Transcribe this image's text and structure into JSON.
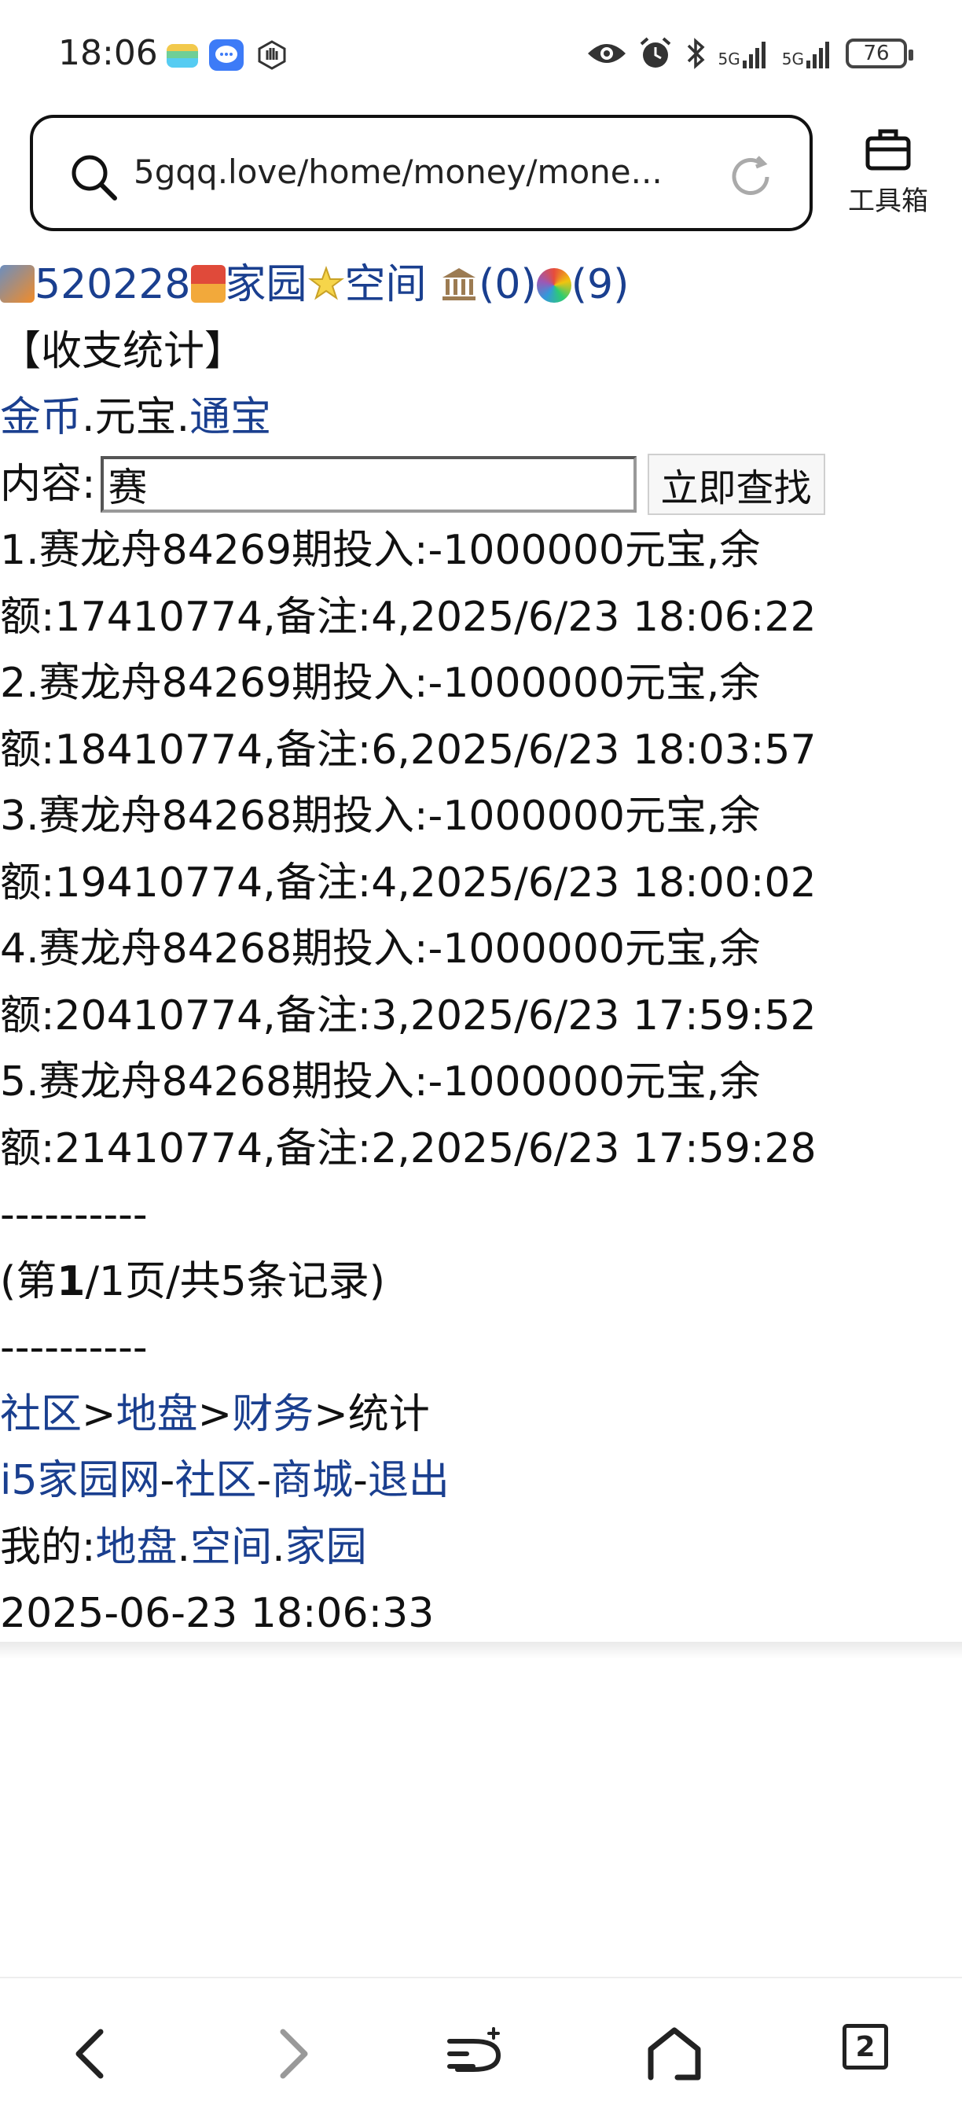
{
  "status_bar": {
    "time": "18:06",
    "battery": "76",
    "network_1": "5G",
    "network_2": "5G",
    "icons": [
      "sim-card-icon",
      "message-icon",
      "hand-icon",
      "eye-icon",
      "alarm-icon",
      "bluetooth-icon",
      "signal-icon",
      "battery-icon"
    ]
  },
  "browser": {
    "url": "5gqq.love/home/money/mone...",
    "toolbox_label": "工具箱",
    "tab_count": "2"
  },
  "page": {
    "top_nav": {
      "user_id": "520228",
      "home_link": "家园",
      "space_link": "空间",
      "bank_count": "(0)",
      "msg_count": "(9)"
    },
    "title": "【收支统计】",
    "currency": {
      "gold": "金币",
      "sep1": ".",
      "yuanbao": "元宝",
      "sep2": ".",
      "tongbao": "通宝"
    },
    "search": {
      "label": "内容:",
      "value": "赛",
      "button": "立即查找"
    },
    "records": [
      "1.赛龙舟84269期投入:-1000000元宝,余额:17410774,备注:4,2025/6/23 18:06:22",
      "2.赛龙舟84269期投入:-1000000元宝,余额:18410774,备注:6,2025/6/23 18:03:57",
      "3.赛龙舟84268期投入:-1000000元宝,余额:19410774,备注:4,2025/6/23 18:00:02",
      "4.赛龙舟84268期投入:-1000000元宝,余额:20410774,备注:3,2025/6/23 17:59:52",
      "5.赛龙舟84268期投入:-1000000元宝,余额:21410774,备注:2,2025/6/23 17:59:28"
    ],
    "divider": "----------",
    "pagination": {
      "prefix": "(第",
      "current": "1",
      "rest": "/1页/共5条记录)"
    },
    "breadcrumb": {
      "community": "社区",
      "gt1": ">",
      "territory": "地盘",
      "gt2": ">",
      "finance": "财务",
      "gt3": ">",
      "current": "统计"
    },
    "footer_links": {
      "site": "i5家园网",
      "sep1": "-",
      "community": "社区",
      "sep2": "-",
      "mall": "商城",
      "sep3": "-",
      "logout": "退出"
    },
    "mine": {
      "label": "我的:",
      "territory": "地盘",
      "sep1": ".",
      "space": "空间",
      "sep2": ".",
      "home": "家园"
    },
    "timestamp": "2025-06-23 18:06:33"
  }
}
